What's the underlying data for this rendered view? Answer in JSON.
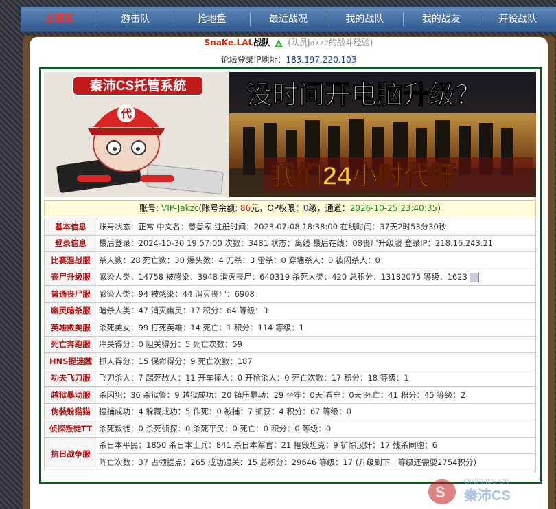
{
  "nav": {
    "items": [
      "正规军",
      "游击队",
      "抢地盘",
      "最近战况",
      "我的战队",
      "我的战友",
      "开设战队"
    ],
    "active_index": 0
  },
  "header": {
    "team_name": "SnaKe.LAL",
    "team_suffix": "战队",
    "subtitle": "(队员Jakzc的战斗经验)",
    "ip_label": "论坛登录IP地址：",
    "ip_value": "183.197.220.103"
  },
  "banner": {
    "logo_text": "秦沛CS托管系統",
    "mascot_cap_text": "代",
    "headline": "没时间开电脑升级？",
    "slogan": "我们24小时代肝"
  },
  "account": {
    "label": "账号: ",
    "id": "VIP-Jakzc",
    "balance_label": "(账号余额: ",
    "balance": "86",
    "balance_unit": "元，OP权限：",
    "op_level": "0",
    "channel_label": "级，通道：",
    "channel_time": "2026-10-25 23:40:35",
    "close": ")"
  },
  "rows": [
    {
      "label": "基本信息",
      "text": "账号状态：正常 中文名：慈善家 注册时间：2023-07-08 18:38:00 在线时间：37天2时53分30秒"
    },
    {
      "label": "登录信息",
      "text": "最后登录：2024-10-30 19:57:00 次数：3481 状态：离线 最后在线：08丧尸升级服 登录IP：218.16.243.21"
    },
    {
      "label": "比赛混战服",
      "text": "杀人数：28 死亡数：30 爆头数：4 刀杀：3 雷杀：0 穿墙杀人：0 被闪杀人：0"
    },
    {
      "label": "丧尸升级服",
      "text": "感染人类：14758 被感染：3948 消灭丧尸：640319 杀死人类：420 总积分：13182075 等级：1623"
    },
    {
      "label": "普通丧尸服",
      "text": "感染人类：94 被感染：44 消灭丧尸：6908"
    },
    {
      "label": "幽灵暗杀服",
      "text": "暗杀人类：47 消灭幽灵：17 积分：64 等级：3"
    },
    {
      "label": "英雄救美服",
      "text": "杀死美女：99 打死英雄：14 死亡：1 积分：114 等级：1"
    },
    {
      "label": "死亡奔跑服",
      "text": "冲关得分：0 阻关得分：5 死亡次数：59"
    },
    {
      "label": "HNS捉迷藏",
      "text": "抓人得分：15 保命得分：9 死亡次数：187"
    },
    {
      "label": "功夫飞刀服",
      "text": "飞刀杀人：7 踢死敌人：11 开车撞人：0 开枪杀人：0 死亡次数：17 积分：18 等级：1"
    },
    {
      "label": "越狱暴动服",
      "text": "杀囚犯：36 杀狱警：9 越狱成功：20 镇压暴动：29 坐牢：0天 看守：0天 死亡：41 积分：45 等级：2"
    },
    {
      "label": "伪装躲猫猫",
      "text": "搜捕成功：4 躲藏成功：5 作死：0 被捕：7 抓获：4 积分：67 等级：0"
    },
    {
      "label": "侦探叛徒TT",
      "text": "杀死叛徒：0 杀死侦探：0 杀死平民：0 死亡：0 积分：0 等级：0"
    },
    {
      "label": "抗日战争服",
      "text": "杀日本平民：1850 杀日本士兵：841 杀日本军官：21 摧毁坦克：9 铲除汉奸：17 残杀同胞：6"
    },
    {
      "label": "",
      "text": "阵亡次数：37 占领据点：265 成功通关：15 总积分：29646 等级：17 (升级到下一等级还需要2754积分)"
    }
  ],
  "watermark": {
    "text": "秦沛CS",
    "url_text": "QINPEICS.CN"
  },
  "colors": {
    "accent_red": "#e21b1b",
    "label_red": "#b31717",
    "value_blue": "#1b3d9c",
    "border_green": "#0b5a22",
    "nav_blue": "#2f5a8f",
    "frame_brown": "#6b4a2b"
  }
}
